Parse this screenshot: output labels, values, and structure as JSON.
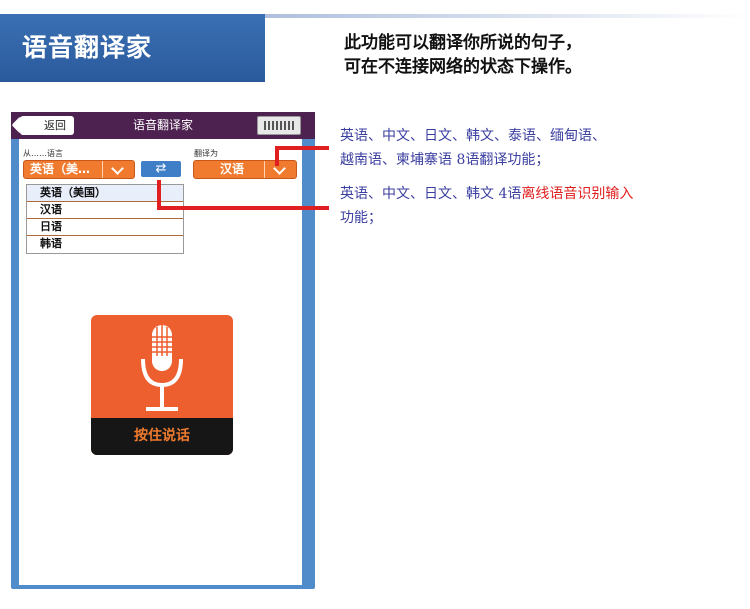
{
  "header": {
    "title": "语音翻译家",
    "description_line1": "此功能可以翻译你所说的句子，",
    "description_line2": "可在不连接网络的状态下操作。"
  },
  "phone": {
    "topbar": {
      "back_label": "返回",
      "title": "语音翻译家"
    },
    "from_label": "从……语言",
    "to_label": "翻译为",
    "from_value": "英语（美…",
    "to_value": "汉语",
    "swap_icon": "⇄",
    "dropdown_options": [
      "英语（美国）",
      "汉语",
      "日语",
      "韩语"
    ],
    "mic_caption": "按住说话"
  },
  "annotations": {
    "feature1_line1": "英语、中文、日文、韩文、泰语、缅甸语、",
    "feature1_line2": "越南语、柬埔寨语 8语翻译功能；",
    "feature2_part1": "英语、中文、日文、韩文 4语",
    "feature2_highlight": "离线语音识别输入",
    "feature2_line2": "功能；"
  },
  "colors": {
    "banner": "#2a5a9c",
    "accent_orange": "#f07b2e",
    "connector_red": "#e02020",
    "annotation_blue": "#3b3fa0"
  }
}
